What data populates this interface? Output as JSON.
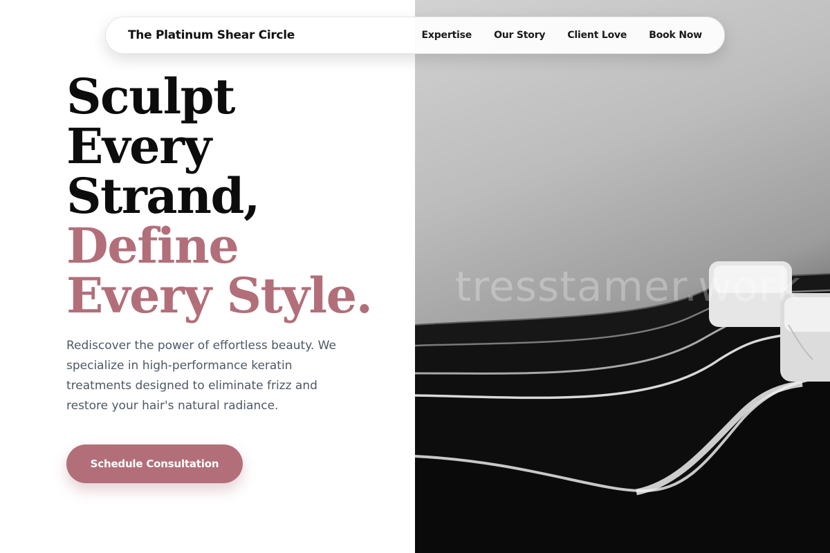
{
  "nav": {
    "brand": "The Platinum Shear Circle",
    "links": [
      "Expertise",
      "Our Story",
      "Client Love",
      "Book Now"
    ]
  },
  "hero": {
    "headline_dark": [
      "Sculpt",
      "Every",
      "Strand,"
    ],
    "headline_accent": [
      "Define",
      "Every Style."
    ],
    "lead": "Rediscover the power of effortless beauty. We specialize in high-performance keratin treatments designed to eliminate frizz and restore your hair's natural radiance.",
    "cta_label": "Schedule Consultation"
  },
  "photo": {
    "subject": "salon-chairs-monochrome",
    "watermark": "tresstamer.work"
  },
  "colors": {
    "accent": "#b26f79",
    "heading": "#0c0c0c",
    "body_text": "#4d5866",
    "background": "#ffffff"
  }
}
